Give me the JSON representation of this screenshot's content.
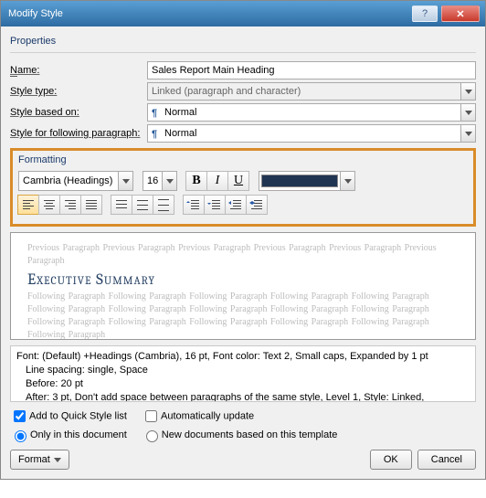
{
  "title": "Modify Style",
  "properties": {
    "group": "Properties",
    "name_label": "Name:",
    "name_value": "Sales Report Main Heading",
    "type_label": "Style type:",
    "type_value": "Linked (paragraph and character)",
    "based_label": "Style based on:",
    "based_value": "Normal",
    "follow_label": "Style for following paragraph:",
    "follow_value": "Normal"
  },
  "formatting": {
    "group": "Formatting",
    "font": "Cambria (Headings)",
    "size": "16",
    "bold": "B",
    "italic": "I",
    "underline": "U",
    "color": "#1f3552"
  },
  "preview": {
    "prev_para": "Previous Paragraph Previous Paragraph Previous Paragraph Previous Paragraph Previous Paragraph Previous Paragraph",
    "sample": "Executive Summary",
    "post_para": "Following Paragraph Following Paragraph Following Paragraph Following Paragraph Following Paragraph Following Paragraph Following Paragraph Following Paragraph Following Paragraph Following Paragraph Following Paragraph Following Paragraph Following Paragraph Following Paragraph Following Paragraph Following Paragraph"
  },
  "desc": {
    "l1": "Font: (Default) +Headings (Cambria), 16 pt, Font color: Text 2, Small caps, Expanded by  1 pt",
    "l2": "Line spacing:  single, Space",
    "l3": "Before:  20 pt",
    "l4": "After:  3 pt, Don't add space between paragraphs of the same style, Level 1, Style: Linked,"
  },
  "checks": {
    "quick": "Add to Quick Style list",
    "auto": "Automatically update",
    "only": "Only in this document",
    "newdoc": "New documents based on this template"
  },
  "footer": {
    "format": "Format",
    "ok": "OK",
    "cancel": "Cancel"
  }
}
